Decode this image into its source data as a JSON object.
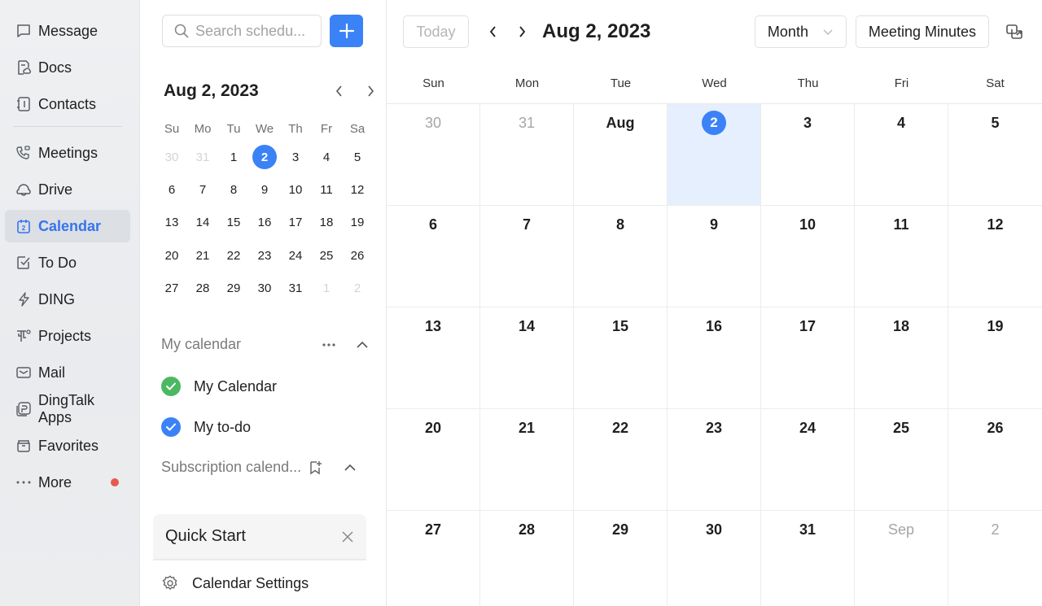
{
  "nav": {
    "items": [
      {
        "label": "Message",
        "icon": "message-icon"
      },
      {
        "label": "Docs",
        "icon": "docs-icon"
      },
      {
        "label": "Contacts",
        "icon": "contacts-icon"
      },
      {
        "label": "Meetings",
        "icon": "meetings-icon"
      },
      {
        "label": "Drive",
        "icon": "drive-icon"
      },
      {
        "label": "Calendar",
        "icon": "calendar-icon",
        "active": true
      },
      {
        "label": "To Do",
        "icon": "todo-icon"
      },
      {
        "label": "DING",
        "icon": "ding-icon"
      },
      {
        "label": "Projects",
        "icon": "projects-icon"
      },
      {
        "label": "Mail",
        "icon": "mail-icon"
      },
      {
        "label": "DingTalk Apps",
        "icon": "apps-icon"
      },
      {
        "label": "Favorites",
        "icon": "favorites-icon"
      },
      {
        "label": "More",
        "icon": "more-icon",
        "badge": "dot"
      }
    ],
    "calendar_icon_number": "2"
  },
  "side": {
    "search_placeholder": "Search schedu...",
    "mini_calendar": {
      "title": "Aug 2, 2023",
      "weekdays": [
        "Su",
        "Mo",
        "Tu",
        "We",
        "Th",
        "Fr",
        "Sa"
      ],
      "days": [
        {
          "d": "30",
          "other": true
        },
        {
          "d": "31",
          "other": true
        },
        {
          "d": "1"
        },
        {
          "d": "2",
          "selected": true
        },
        {
          "d": "3"
        },
        {
          "d": "4"
        },
        {
          "d": "5"
        },
        {
          "d": "6"
        },
        {
          "d": "7"
        },
        {
          "d": "8"
        },
        {
          "d": "9"
        },
        {
          "d": "10"
        },
        {
          "d": "11"
        },
        {
          "d": "12"
        },
        {
          "d": "13"
        },
        {
          "d": "14"
        },
        {
          "d": "15"
        },
        {
          "d": "16"
        },
        {
          "d": "17"
        },
        {
          "d": "18"
        },
        {
          "d": "19"
        },
        {
          "d": "20"
        },
        {
          "d": "21"
        },
        {
          "d": "22"
        },
        {
          "d": "23"
        },
        {
          "d": "24"
        },
        {
          "d": "25"
        },
        {
          "d": "26"
        },
        {
          "d": "27"
        },
        {
          "d": "28"
        },
        {
          "d": "29"
        },
        {
          "d": "30"
        },
        {
          "d": "31"
        },
        {
          "d": "1",
          "other": true
        },
        {
          "d": "2",
          "other": true
        }
      ]
    },
    "my_calendar_label": "My calendar",
    "calendars": [
      {
        "label": "My Calendar",
        "color": "#4cb862"
      },
      {
        "label": "My to-do",
        "color": "#3b82f6"
      }
    ],
    "subscription_label": "Subscription calend...",
    "quick_start": "Quick Start",
    "settings_label": "Calendar Settings"
  },
  "main": {
    "today_label": "Today",
    "title": "Aug 2, 2023",
    "view_label": "Month",
    "minutes_label": "Meeting Minutes",
    "weekdays": [
      "Sun",
      "Mon",
      "Tue",
      "Wed",
      "Thu",
      "Fri",
      "Sat"
    ],
    "cells": [
      {
        "d": "30",
        "other": true
      },
      {
        "d": "31",
        "other": true
      },
      {
        "d": "Aug"
      },
      {
        "d": "2",
        "today": true
      },
      {
        "d": "3"
      },
      {
        "d": "4"
      },
      {
        "d": "5"
      },
      {
        "d": "6"
      },
      {
        "d": "7"
      },
      {
        "d": "8"
      },
      {
        "d": "9"
      },
      {
        "d": "10"
      },
      {
        "d": "11"
      },
      {
        "d": "12"
      },
      {
        "d": "13"
      },
      {
        "d": "14"
      },
      {
        "d": "15"
      },
      {
        "d": "16"
      },
      {
        "d": "17"
      },
      {
        "d": "18"
      },
      {
        "d": "19"
      },
      {
        "d": "20"
      },
      {
        "d": "21"
      },
      {
        "d": "22"
      },
      {
        "d": "23"
      },
      {
        "d": "24"
      },
      {
        "d": "25"
      },
      {
        "d": "26"
      },
      {
        "d": "27"
      },
      {
        "d": "28"
      },
      {
        "d": "29"
      },
      {
        "d": "30"
      },
      {
        "d": "31"
      },
      {
        "d": "Sep",
        "other": true
      },
      {
        "d": "2",
        "other": true
      }
    ],
    "accent": "#3b82f6",
    "today_bg": "#e6effd"
  }
}
